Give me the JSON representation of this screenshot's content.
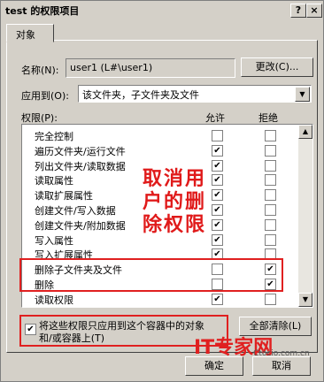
{
  "window": {
    "title": "test 的权限项目",
    "help_glyph": "?",
    "close_glyph": "×"
  },
  "tab": {
    "label": "对象"
  },
  "name_row": {
    "label": "名称(N):",
    "value": "user1 (L#\\user1)",
    "change_button": "更改(C)..."
  },
  "apply_row": {
    "label": "应用到(O):",
    "value": "该文件夹，子文件夹及文件"
  },
  "permissions": {
    "header_label": "权限(P):",
    "allow_header": "允许",
    "deny_header": "拒绝",
    "rows": [
      {
        "name": "完全控制",
        "allow": false,
        "deny": false
      },
      {
        "name": "遍历文件夹/运行文件",
        "allow": true,
        "deny": false
      },
      {
        "name": "列出文件夹/读取数据",
        "allow": true,
        "deny": false
      },
      {
        "name": "读取属性",
        "allow": true,
        "deny": false
      },
      {
        "name": "读取扩展属性",
        "allow": true,
        "deny": false
      },
      {
        "name": "创建文件/写入数据",
        "allow": true,
        "deny": false
      },
      {
        "name": "创建文件夹/附加数据",
        "allow": true,
        "deny": false
      },
      {
        "name": "写入属性",
        "allow": true,
        "deny": false
      },
      {
        "name": "写入扩展属性",
        "allow": true,
        "deny": false
      },
      {
        "name": "删除子文件夹及文件",
        "allow": false,
        "deny": true
      },
      {
        "name": "删除",
        "allow": false,
        "deny": true
      },
      {
        "name": "读取权限",
        "allow": true,
        "deny": false
      }
    ]
  },
  "apply_only": {
    "checked": true,
    "label_line1": "将这些权限只应用到这个容器中的对象",
    "label_line2": "和/或容器上(T)"
  },
  "clear_all_button": "全部清除(L)",
  "ok_button": "确定",
  "cancel_button": "取消",
  "annotation": {
    "line1": "取消用",
    "line2": "户的删",
    "line3": "除权限"
  },
  "watermark": {
    "text": "IT专家网",
    "sub": "Ctocio.com.cn"
  },
  "colors": {
    "highlight": "#e02020",
    "dialog_bg": "#d4d0c8"
  }
}
